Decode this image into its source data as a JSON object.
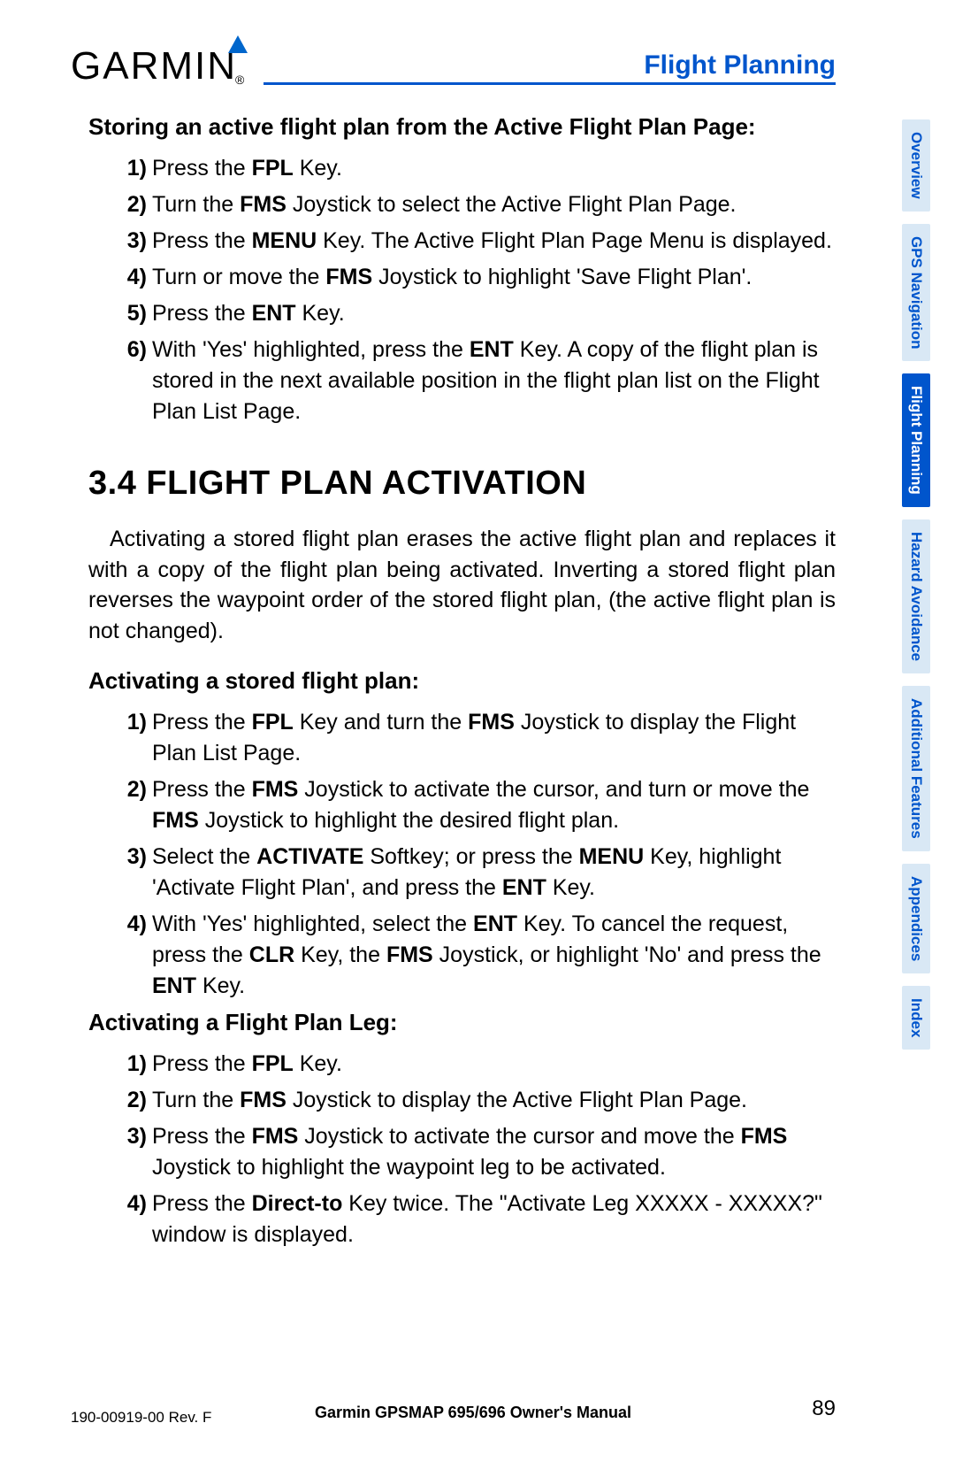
{
  "logo": {
    "text": "GARMIN",
    "registered": "®"
  },
  "header": {
    "title": "Flight Planning"
  },
  "sections": {
    "sub1_title": "Storing an active flight plan from the Active Flight Plan Page:",
    "sub1_items": {
      "n1": "1)",
      "n2": "2)",
      "n3": "3)",
      "n4": "4)",
      "n5": "5)",
      "n6": "6)",
      "t1a": "Press the ",
      "t1b": "FPL",
      "t1c": " Key.",
      "t2a": "Turn the ",
      "t2b": "FMS",
      "t2c": " Joystick to select the Active Flight Plan Page.",
      "t3a": "Press the ",
      "t3b": "MENU",
      "t3c": " Key.  The Active Flight Plan Page Menu is displayed.",
      "t4a": "Turn or move the ",
      "t4b": "FMS",
      "t4c": " Joystick to highlight 'Save Flight Plan'.",
      "t5a": "Press the ",
      "t5b": "ENT",
      "t5c": " Key.",
      "t6a": "With 'Yes' highlighted, press the ",
      "t6b": "ENT",
      "t6c": " Key.  A copy of the flight plan is stored in the next available position in the flight plan list on the Flight Plan List Page."
    },
    "heading": "3.4 FLIGHT PLAN ACTIVATION",
    "para1": "Activating a stored flight plan erases the active flight plan and replaces it with a copy of the flight plan being activated.  Inverting a stored flight plan reverses the waypoint order of the stored flight plan, (the active flight plan is not changed).",
    "sub2_title": "Activating a stored flight plan:",
    "sub2_items": {
      "n1": "1)",
      "n2": "2)",
      "n3": "3)",
      "n4": "4)",
      "t1a": "Press the ",
      "t1b": "FPL",
      "t1c": " Key and turn the ",
      "t1d": "FMS",
      "t1e": " Joystick to display the Flight Plan List Page.",
      "t2a": "Press the ",
      "t2b": "FMS",
      "t2c": " Joystick to activate the cursor, and turn or move the ",
      "t2d": "FMS",
      "t2e": " Joystick to highlight the desired flight plan.",
      "t3a": "Select the ",
      "t3b": "ACTIVATE",
      "t3c": " Softkey; or press the ",
      "t3d": "MENU",
      "t3e": " Key, highlight 'Activate Flight Plan', and press the ",
      "t3f": "ENT",
      "t3g": " Key.",
      "t4a": "With 'Yes' highlighted, select the ",
      "t4b": "ENT",
      "t4c": " Key.  To cancel the request, press the ",
      "t4d": "CLR",
      "t4e": " Key, the ",
      "t4f": "FMS",
      "t4g": " Joystick, or highlight 'No' and press the ",
      "t4h": "ENT",
      "t4i": " Key."
    },
    "sub3_title": "Activating a Flight Plan Leg:",
    "sub3_items": {
      "n1": "1)",
      "n2": "2)",
      "n3": "3)",
      "n4": "4)",
      "t1a": "Press the ",
      "t1b": "FPL",
      "t1c": " Key.",
      "t2a": "Turn the ",
      "t2b": "FMS",
      "t2c": " Joystick to display the Active Flight Plan Page.",
      "t3a": "Press the ",
      "t3b": "FMS",
      "t3c": " Joystick to activate the cursor and move the ",
      "t3d": "FMS",
      "t3e": " Joystick to highlight the waypoint leg to be activated.",
      "t4a": "Press the ",
      "t4b": "Direct-to",
      "t4c": " Key twice.  The \"Activate Leg XXXXX - XXXXX?\" window is displayed."
    }
  },
  "tabs": {
    "t1": "Overview",
    "t2": "GPS Navigation",
    "t3": "Flight Planning",
    "t4": "Hazard Avoidance",
    "t5": "Additional Features",
    "t6": "Appendices",
    "t7": "Index"
  },
  "footer": {
    "left": "190-00919-00  Rev. F",
    "center": "Garmin GPSMAP 695/696 Owner's Manual",
    "right": "89"
  }
}
